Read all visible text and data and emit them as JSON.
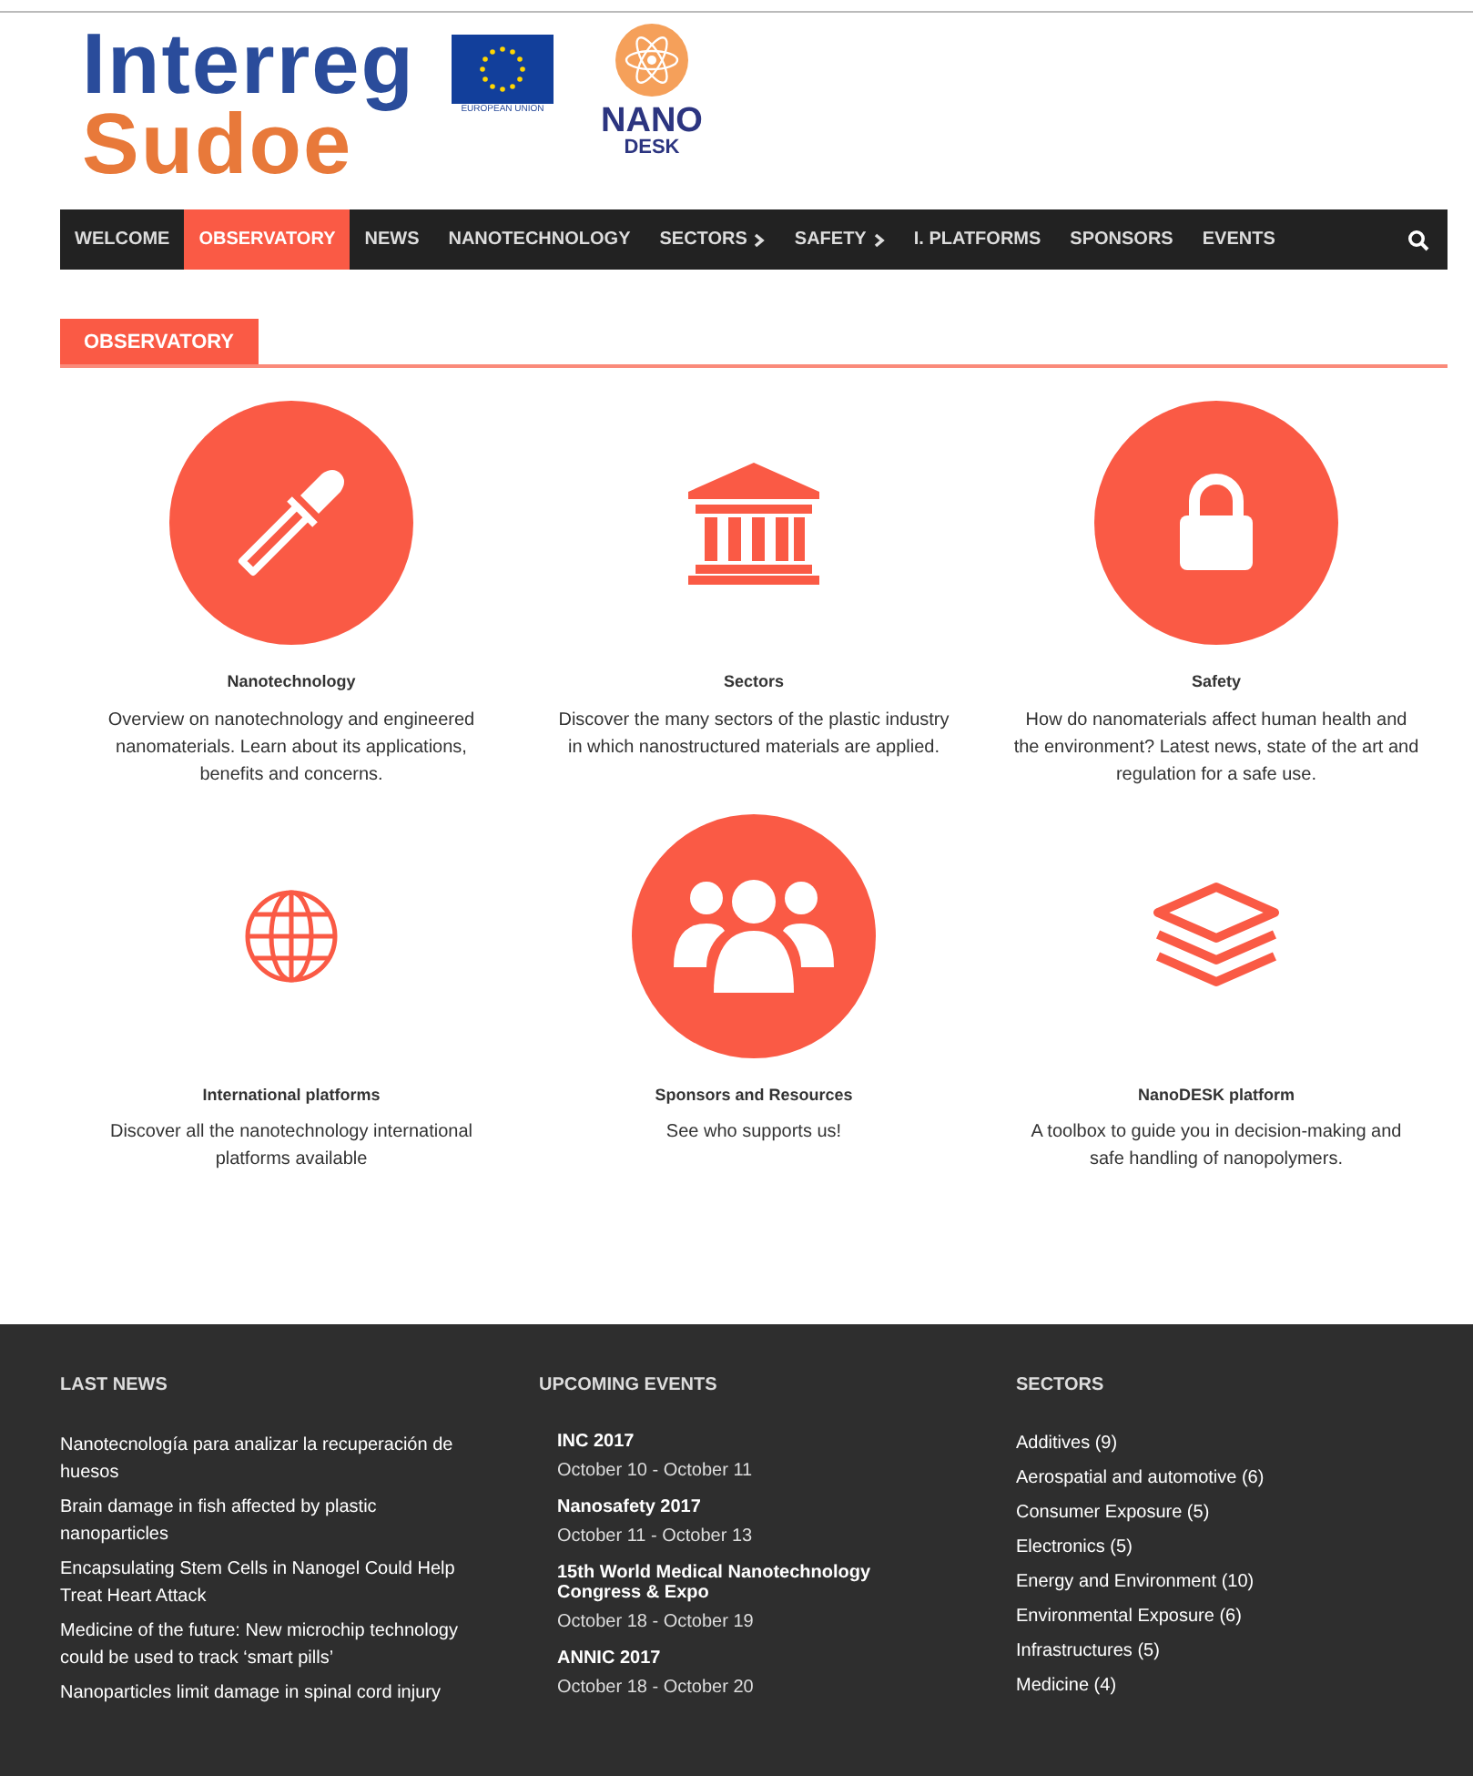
{
  "header": {
    "logo_line_1": "Interreg",
    "logo_line_2": "Sudoe",
    "eu_caption": "EUROPEAN UNION",
    "project_line_1": "NANO",
    "project_line_2": "DESK"
  },
  "nav": {
    "items": [
      {
        "label": "WELCOME",
        "selected": false,
        "submenu": false
      },
      {
        "label": "OBSERVATORY",
        "selected": true,
        "submenu": false
      },
      {
        "label": "NEWS",
        "selected": false,
        "submenu": false
      },
      {
        "label": "NANOTECHNOLOGY",
        "selected": false,
        "submenu": false
      },
      {
        "label": "SECTORS",
        "selected": false,
        "submenu": true
      },
      {
        "label": "SAFETY",
        "selected": false,
        "submenu": true
      },
      {
        "label": "I. PLATFORMS",
        "selected": false,
        "submenu": false
      },
      {
        "label": "SPONSORS",
        "selected": false,
        "submenu": false
      },
      {
        "label": "EVENTS",
        "selected": false,
        "submenu": false
      }
    ]
  },
  "section_title": "OBSERVATORY",
  "features": [
    {
      "title": "Nanotechnology",
      "description": "Overview on nanotechnology and engineered nanomaterials. Learn about its applications, benefits and concerns.",
      "kind": "circled"
    },
    {
      "title": "Sectors",
      "description": "Discover the many sectors of the plastic industry in which nanostructured materials are applied.",
      "kind": "plain"
    },
    {
      "title": "Safety",
      "description": "How do nanomaterials affect human health and the environment? Latest news, state of the art and regulation for a safe use.",
      "kind": "circled"
    },
    {
      "title": "International platforms",
      "description": "Discover all the nanotechnology international platforms available",
      "kind": "plain"
    },
    {
      "title": "Sponsors and Resources",
      "description": "See who supports us!",
      "kind": "circled"
    },
    {
      "title": "NanoDESK platform",
      "description": "A toolbox to guide you in decision-making and safe handling of nanopolymers.",
      "kind": "plain"
    }
  ],
  "footer": {
    "last_news": {
      "heading": "LAST NEWS",
      "items": [
        "Nanotecnología para analizar la recuperación de huesos",
        "Brain damage in fish affected by plastic nanoparticles",
        "Encapsulating Stem Cells in Nanogel Could Help Treat Heart Attack",
        "Medicine of the future: New microchip technology could be used to track ‘smart pills’",
        "Nanoparticles limit damage in spinal cord injury"
      ]
    },
    "upcoming_events": {
      "heading": "UPCOMING EVENTS",
      "items": [
        {
          "name": "INC 2017",
          "dates": "October 10 - October 11"
        },
        {
          "name": "Nanosafety 2017",
          "dates": "October 11 - October 13"
        },
        {
          "name": "15th World Medical Nanotechnology Congress & Expo",
          "dates": "October 18 - October 19"
        },
        {
          "name": "ANNIC 2017",
          "dates": "October 18 - October 20"
        }
      ]
    },
    "sectors": {
      "heading": "SECTORS",
      "items": [
        "Additives (9)",
        "Aerospatial and automotive (6)",
        "Consumer Exposure (5)",
        "Electronics (5)",
        "Energy and Environment (10)",
        "Environmental Exposure (6)",
        "Infrastructures (5)",
        "Medicine (4)"
      ]
    }
  }
}
